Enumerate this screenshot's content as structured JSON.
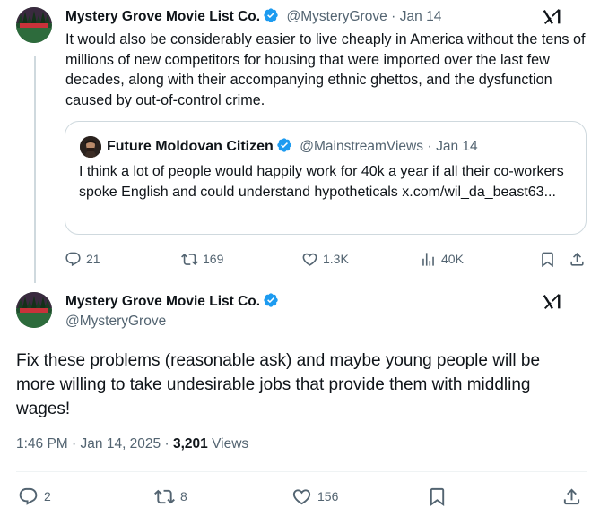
{
  "tweet1": {
    "author_name": "Mystery Grove Movie List Co.",
    "handle": "@MysteryGrove",
    "date": "Jan 14",
    "separator": "·",
    "text": "It would also be considerably easier to live cheaply in America without the tens of millions of new competitors for housing that were imported over the last few decades, along with their accompanying ethnic ghettos, and the dysfunction caused by out-of-control crime.",
    "quote": {
      "author_name": "Future Moldovan Citizen",
      "handle": "@MainstreamViews",
      "date": "Jan 14",
      "separator": "·",
      "text": "I think a lot of people would happily work for 40k a year if all their co-workers spoke English and could understand hypotheticals",
      "link": "x.com/wil_da_beast63..."
    },
    "actions": {
      "replies": "21",
      "reposts": "169",
      "likes": "1.3K",
      "views": "40K"
    }
  },
  "tweet2": {
    "author_name": "Mystery Grove Movie List Co.",
    "handle": "@MysteryGrove",
    "text": "Fix these problems (reasonable ask) and maybe young people will be more willing to take undesirable jobs that provide them with middling wages!",
    "time": "1:46 PM",
    "date": "Jan 14, 2025",
    "separator": "·",
    "views_count": "3,201",
    "views_label": "Views",
    "actions": {
      "replies": "2",
      "reposts": "8",
      "likes": "156"
    }
  },
  "avatar_text": {
    "line1": "MYSTERY GROVE",
    "line2": "PUBLISHING",
    "line3": "CO."
  },
  "icons": [
    "verified-badge-icon",
    "grok-icon",
    "reply-icon",
    "repost-icon",
    "like-icon",
    "views-icon",
    "bookmark-icon",
    "share-icon"
  ],
  "colors": {
    "text": "#0f1419",
    "muted": "#536471",
    "verified": "#1d9bf0",
    "border": "#cfd9de",
    "avatar_bg": "#2d6b3c",
    "avatar_banner": "#c8323a"
  }
}
